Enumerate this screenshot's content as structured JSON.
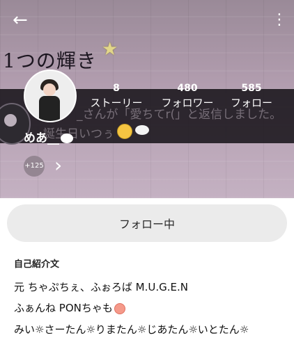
{
  "header": {
    "back_icon": "arrow-left-icon",
    "menu_icon": "more-vertical-icon",
    "handwriting": "1つの輝き"
  },
  "stats": [
    {
      "value": "8",
      "label": "ストーリー"
    },
    {
      "value": "480",
      "label": "フォロワー"
    },
    {
      "value": "585",
      "label": "フォロー"
    }
  ],
  "background_text": {
    "line1": "_さんが「愛ちてr(」と返信しました。",
    "line2": "誕生日いつぅ"
  },
  "profile": {
    "username": "めあ__",
    "followers_badge": "+125"
  },
  "follow_button": {
    "label": "フォロー中"
  },
  "bio": {
    "title": "自己紹介文",
    "lines": [
      "元 ちゃぷちぇ、ふぉろば M.U.G.E.N",
      "ふぁんね PONちゃも",
      "みい☼さーたん☼りまたん☼じあたん☼いとたん☼"
    ]
  },
  "colors": {
    "header_overlay": "#141016",
    "button_bg": "#ebebeb",
    "badge_bg": "#948692"
  }
}
